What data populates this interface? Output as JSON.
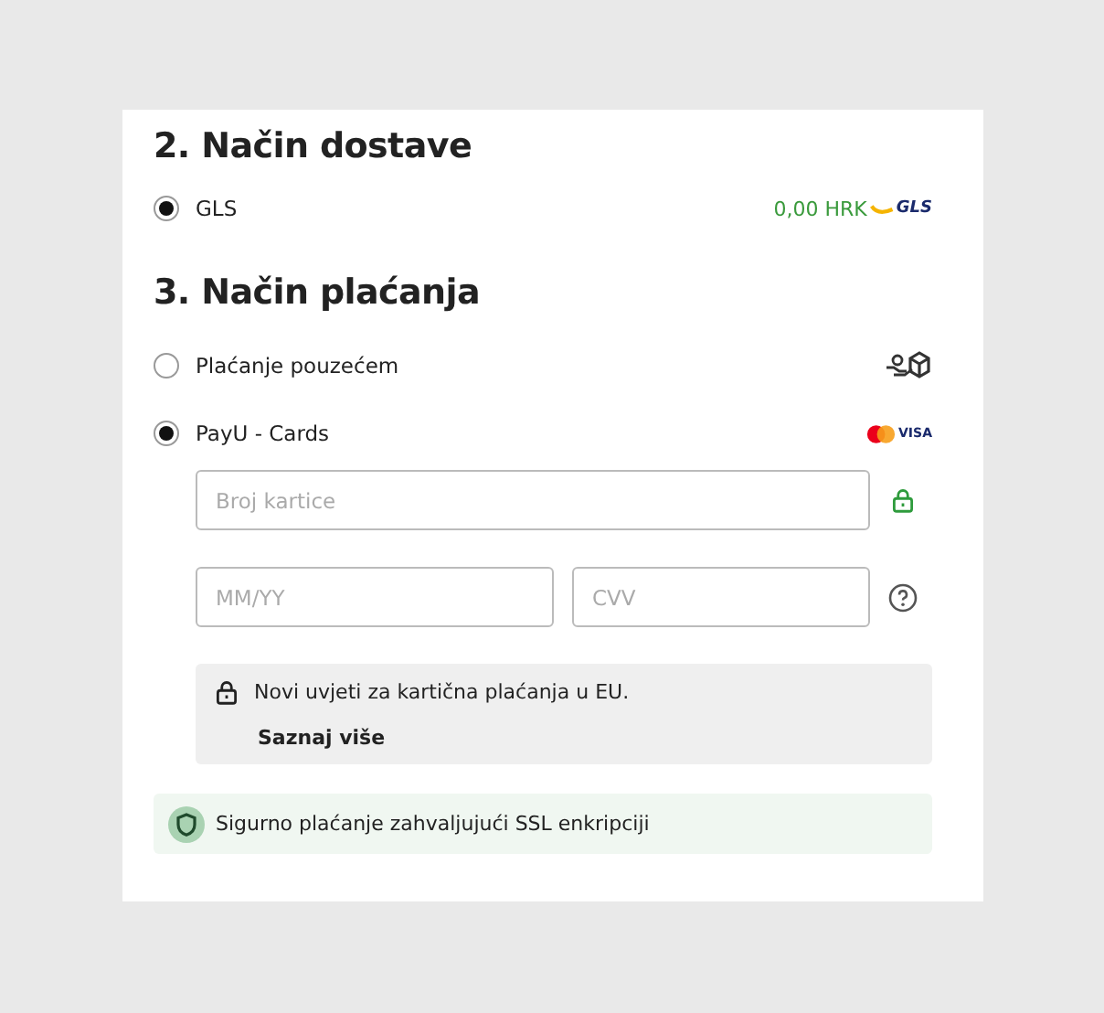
{
  "delivery": {
    "heading": "2. Način dostave",
    "options": [
      {
        "label": "GLS",
        "selected": true,
        "price": "0,00 HRK",
        "logo": "GLS"
      }
    ]
  },
  "payment": {
    "heading": "3. Način plaćanja",
    "methods": [
      {
        "label": "Plaćanje pouzećem",
        "selected": false,
        "kind": "cod"
      },
      {
        "label": "PayU - Cards",
        "selected": true,
        "kind": "cards",
        "brand": "VISA"
      }
    ],
    "card_form": {
      "number": {
        "placeholder": "Broj kartice"
      },
      "expiry": {
        "placeholder": "MM/YY"
      },
      "cvv": {
        "placeholder": "CVV"
      }
    },
    "notice": {
      "text": "Novi uvjeti za kartična plaćanja u EU.",
      "link": "Saznaj više"
    },
    "security": "Sigurno plaćanje zahvaljujući SSL enkripciji"
  }
}
